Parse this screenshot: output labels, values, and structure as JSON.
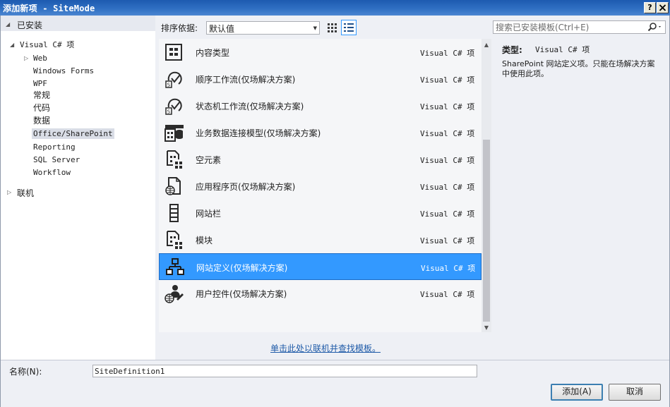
{
  "window": {
    "title": "添加新项 - SiteMode",
    "help_label": "?",
    "close_label": "X"
  },
  "tree": {
    "installed_label": "已安装",
    "root": "Visual C# 项",
    "children": [
      "Web",
      "Windows Forms",
      "WPF",
      "常规",
      "代码",
      "数据",
      "Office/SharePoint",
      "Reporting",
      "SQL Server",
      "Workflow"
    ],
    "selected": "Office/SharePoint",
    "online_label": "联机"
  },
  "toolbar": {
    "sort_label": "排序依据:",
    "sort_value": "默认值",
    "search_placeholder": "搜索已安装模板(Ctrl+E)"
  },
  "templates": [
    {
      "name": "内容类型",
      "lang": "Visual C# 项",
      "icon": "content-type-icon"
    },
    {
      "name": "顺序工作流(仅场解决方案)",
      "lang": "Visual C# 项",
      "icon": "sequential-workflow-icon"
    },
    {
      "name": "状态机工作流(仅场解决方案)",
      "lang": "Visual C# 项",
      "icon": "state-machine-workflow-icon"
    },
    {
      "name": "业务数据连接模型(仅场解决方案)",
      "lang": "Visual C# 项",
      "icon": "business-data-model-icon"
    },
    {
      "name": "空元素",
      "lang": "Visual C# 项",
      "icon": "empty-element-icon"
    },
    {
      "name": "应用程序页(仅场解决方案)",
      "lang": "Visual C# 项",
      "icon": "application-page-icon"
    },
    {
      "name": "网站栏",
      "lang": "Visual C# 项",
      "icon": "site-column-icon"
    },
    {
      "name": "模块",
      "lang": "Visual C# 项",
      "icon": "module-icon"
    },
    {
      "name": "网站定义(仅场解决方案)",
      "lang": "Visual C# 项",
      "icon": "site-definition-icon"
    },
    {
      "name": "用户控件(仅场解决方案)",
      "lang": "Visual C# 项",
      "icon": "user-control-icon"
    }
  ],
  "selected_template_index": 8,
  "info": {
    "type_label": "类型:",
    "type_value": "Visual C# 项",
    "description": "SharePoint 网站定义项。只能在场解决方案中使用此项。"
  },
  "online_link": "单击此处以联机并查找模板。",
  "footer": {
    "name_label": "名称(N):",
    "name_value": "SiteDefinition1",
    "add_label": "添加(A)",
    "cancel_label": "取消"
  },
  "colors": {
    "title_bar": "#2f6fc2",
    "selection": "#3399ff",
    "link": "#1e5aa8"
  }
}
